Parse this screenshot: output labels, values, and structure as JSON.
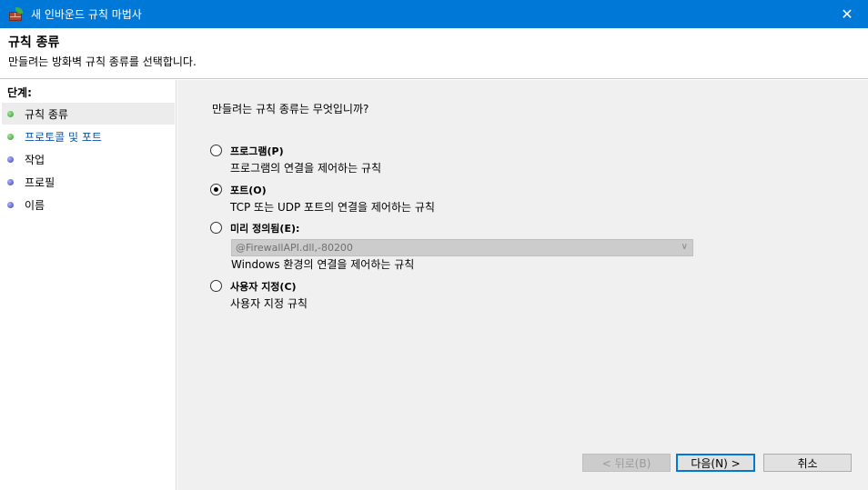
{
  "window": {
    "title": "새 인바운드 규칙 마법사",
    "close_icon_glyph": "✕"
  },
  "header": {
    "title": "규칙 종류",
    "description": "만들려는 방화벽 규칙 종류를 선택합니다."
  },
  "sidebar": {
    "title": "단계:",
    "steps": [
      {
        "label": "규칙 종류",
        "bullet": "green",
        "active": true
      },
      {
        "label": "프로토콜 및 포트",
        "bullet": "green",
        "link": true
      },
      {
        "label": "작업",
        "bullet": "blue"
      },
      {
        "label": "프로필",
        "bullet": "blue"
      },
      {
        "label": "이름",
        "bullet": "blue"
      }
    ]
  },
  "main": {
    "question": "만들려는 규칙 종류는 무엇입니까?",
    "options": [
      {
        "label": "프로그램(P)",
        "description": "프로그램의 연결을 제어하는 규칙",
        "checked": false
      },
      {
        "label": "포트(O)",
        "description": "TCP 또는 UDP 포트의 연결을 제어하는 규칙",
        "checked": true
      },
      {
        "label": "미리 정의됨(E):",
        "description": "Windows 환경의 연결을 제어하는 규칙",
        "checked": false
      },
      {
        "label": "사용자 지정(C)",
        "description": "사용자 지정 규칙",
        "checked": false
      }
    ],
    "predefined_combo": {
      "value": "@FirewallAPI.dll,-80200",
      "disabled": true
    }
  },
  "buttons": {
    "back": "< 뒤로(B)",
    "next": "다음(N) >",
    "cancel": "취소"
  }
}
